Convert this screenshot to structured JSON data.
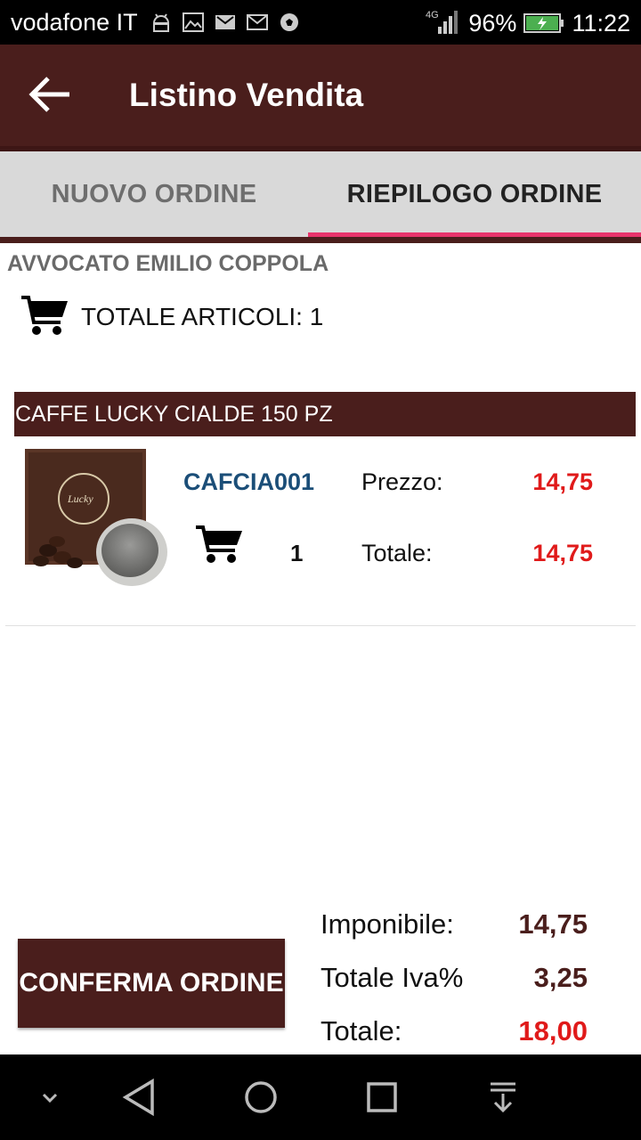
{
  "status_bar": {
    "carrier": "vodafone IT",
    "network": "4G",
    "battery": "96%",
    "time": "11:22",
    "icons": [
      "android-debug-icon",
      "image-icon",
      "gmail-icon",
      "email-icon",
      "soccer-ball-icon"
    ]
  },
  "app_bar": {
    "title": "Listino Vendita",
    "back_icon": "arrow-back-icon"
  },
  "tabs": [
    {
      "label": "NUOVO ORDINE",
      "active": false
    },
    {
      "label": "RIEPILOGO ORDINE",
      "active": true
    }
  ],
  "order": {
    "customer": "AVVOCATO EMILIO COPPOLA",
    "total_items": "TOTALE ARTICOLI: 1",
    "product": {
      "name": "CAFFE LUCKY CIALDE 150 PZ",
      "code": "CAFCIA001",
      "quantity": "1",
      "price_label": "Prezzo:",
      "price_value": "14,75",
      "total_label": "Totale:",
      "total_value": "14,75"
    }
  },
  "summary": {
    "confirm_label": "CONFERMA ORDINE",
    "imponibile_label": "Imponibile:",
    "imponibile_value": "14,75",
    "iva_label": "Totale Iva%",
    "iva_value": "3,25",
    "totale_label": "Totale:",
    "totale_value": "18,00"
  },
  "colors": {
    "brand": "#4a1e1c",
    "accent": "#e8336b",
    "price": "#e01a1a",
    "code": "#1b4e78"
  }
}
